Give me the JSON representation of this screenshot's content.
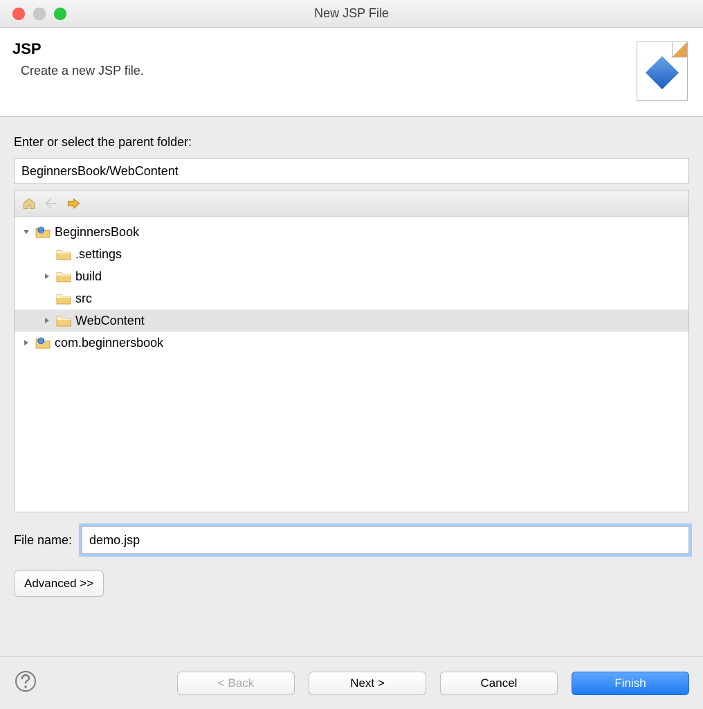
{
  "window": {
    "title": "New JSP File"
  },
  "header": {
    "title": "JSP",
    "subtitle": "Create a new JSP file."
  },
  "prompt": "Enter or select the parent folder:",
  "parent_folder_value": "BeginnersBook/WebContent",
  "tree": {
    "toolbar_icons": {
      "home": "home-icon",
      "back": "back-arrow-icon",
      "forward": "forward-arrow-icon"
    },
    "items": [
      {
        "label": "BeginnersBook",
        "depth": 0,
        "expandable": true,
        "expanded": true,
        "icon": "project",
        "selected": false
      },
      {
        "label": ".settings",
        "depth": 1,
        "expandable": false,
        "expanded": false,
        "icon": "folder",
        "selected": false
      },
      {
        "label": "build",
        "depth": 1,
        "expandable": true,
        "expanded": false,
        "icon": "folder",
        "selected": false
      },
      {
        "label": "src",
        "depth": 1,
        "expandable": false,
        "expanded": false,
        "icon": "folder",
        "selected": false
      },
      {
        "label": "WebContent",
        "depth": 1,
        "expandable": true,
        "expanded": false,
        "icon": "folder",
        "selected": true
      },
      {
        "label": "com.beginnersbook",
        "depth": 0,
        "expandable": true,
        "expanded": false,
        "icon": "project",
        "selected": false
      }
    ]
  },
  "file_name": {
    "label": "File name:",
    "value": "demo.jsp"
  },
  "advanced_label": "Advanced >>",
  "buttons": {
    "back": "< Back",
    "next": "Next >",
    "cancel": "Cancel",
    "finish": "Finish"
  }
}
